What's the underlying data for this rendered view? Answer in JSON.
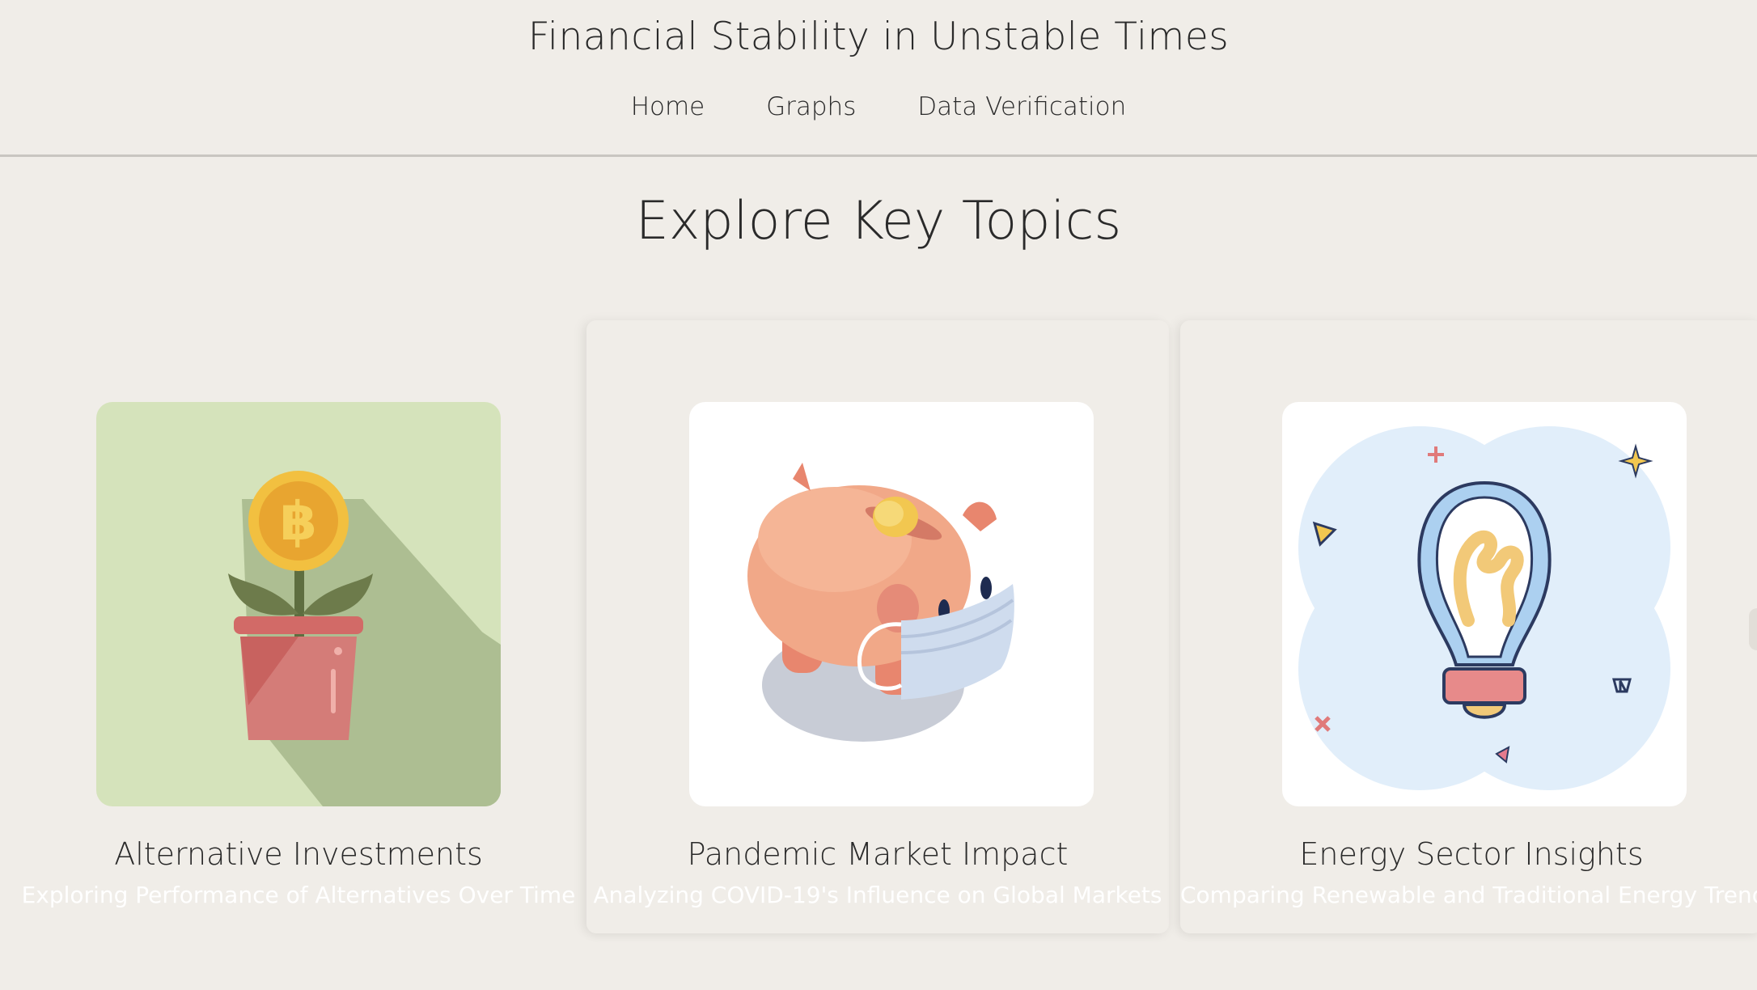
{
  "header": {
    "title": "Financial Stability in Unstable Times",
    "nav": [
      {
        "label": "Home"
      },
      {
        "label": "Graphs"
      },
      {
        "label": "Data Verification"
      }
    ]
  },
  "main": {
    "section_title": "Explore Key Topics",
    "cards": [
      {
        "title": "Alternative Investments",
        "subtitle": "Exploring Performance of Alternatives Over Time",
        "icon": "bitcoin-plant-icon",
        "bg": "#d5e3bb"
      },
      {
        "title": "Pandemic Market Impact",
        "subtitle": "Analyzing COVID-19's Influence on Global Markets",
        "icon": "masked-piggy-bank-icon",
        "bg": "#ffffff"
      },
      {
        "title": "Energy Sector Insights",
        "subtitle": "Comparing Renewable and Traditional Energy Trends",
        "icon": "lightbulb-icon",
        "bg": "#ffffff"
      }
    ]
  },
  "colors": {
    "background": "#f0ede8",
    "text": "#2a2a2a",
    "subtitle": "#ffffff"
  }
}
